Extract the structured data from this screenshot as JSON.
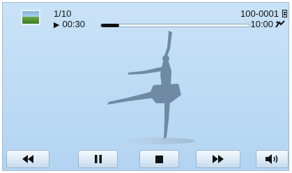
{
  "status": {
    "file_counter": "1/10",
    "play_icon": "play-icon",
    "elapsed": "00:30",
    "file_id": "100-0001",
    "total": "10:00",
    "progress_fraction": 0.12
  },
  "indicators": [
    "thumbnail",
    "battery-icon",
    "anti-shake-icon"
  ],
  "controls": [
    {
      "name": "rewind",
      "icon": "rewind-icon"
    },
    {
      "name": "pause",
      "icon": "pause-icon"
    },
    {
      "name": "stop",
      "icon": "stop-icon"
    },
    {
      "name": "fast-forward",
      "icon": "fast-forward-icon"
    },
    {
      "name": "volume",
      "icon": "volume-icon"
    }
  ],
  "colors": {
    "background": "#bcdaf4",
    "silhouette": "#6f8aa2",
    "text": "#111111"
  }
}
